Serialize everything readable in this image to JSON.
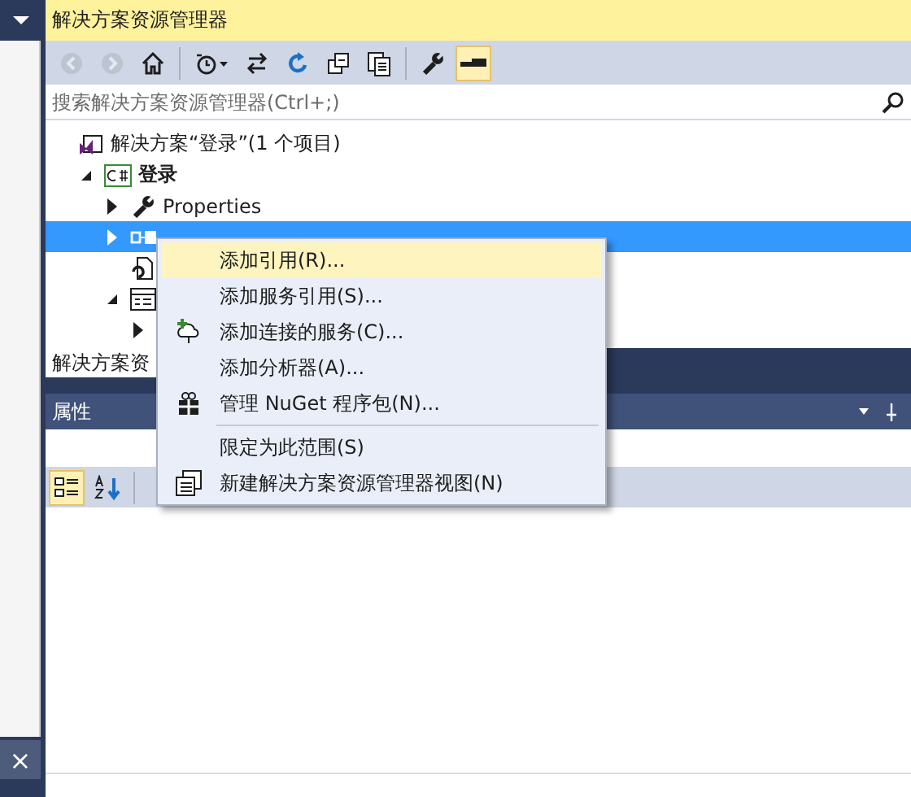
{
  "side_panel": {
    "close_label": "×"
  },
  "window": {
    "title": "解决方案资源管理器"
  },
  "toolbar": [
    {
      "kind": "back",
      "disabled": true
    },
    {
      "kind": "forward",
      "disabled": true
    },
    {
      "kind": "home",
      "disabled": false
    },
    {
      "kind": "separator"
    },
    {
      "kind": "history",
      "disabled": false
    },
    {
      "kind": "sync",
      "disabled": false
    },
    {
      "kind": "refresh",
      "disabled": false
    },
    {
      "kind": "collapse",
      "disabled": false
    },
    {
      "kind": "show_all",
      "disabled": false
    },
    {
      "kind": "separator"
    },
    {
      "kind": "properties",
      "disabled": false
    },
    {
      "kind": "preview",
      "disabled": false,
      "selected": true
    }
  ],
  "search": {
    "placeholder": "搜索解决方案资源管理器(Ctrl+;)"
  },
  "tree": [
    {
      "label": "解决方案“登录”(1 个项目)",
      "kind": "solution",
      "selected": false,
      "children": [
        {
          "label": "登录",
          "kind": "project",
          "expanded": true,
          "selected": false,
          "children": [
            {
              "label": "Properties",
              "kind": "properties",
              "expanded": false,
              "selected": false
            },
            {
              "kind": "references",
              "expanded": false,
              "selected": true
            },
            {
              "kind": "config",
              "selected": false
            },
            {
              "kind": "form",
              "expanded": true,
              "selected": false,
              "children": [
                {
                  "expanded": false,
                  "selected": false
                }
              ]
            }
          ]
        }
      ]
    }
  ],
  "tabs": [
    {
      "label": "解决方案资",
      "selected": true
    }
  ],
  "properties": {
    "title": "属性",
    "toolbar": [
      {
        "kind": "categorized",
        "selected": true
      },
      {
        "kind": "alphabetical",
        "selected": false
      }
    ]
  },
  "context_menu": [
    {
      "kind": "plain",
      "label": "添加引用(R)...",
      "selected": true
    },
    {
      "kind": "plain",
      "label": "添加服务引用(S)...",
      "selected": false
    },
    {
      "kind": "connected",
      "label": "添加连接的服务(C)...",
      "selected": false
    },
    {
      "kind": "plain",
      "label": "添加分析器(A)...",
      "selected": false
    },
    {
      "kind": "nuget",
      "label": "管理 NuGet 程序包(N)...",
      "selected": false
    },
    {
      "kind": "separator"
    },
    {
      "kind": "plain",
      "label": "限定为此范围(S)",
      "selected": false
    },
    {
      "kind": "new_view",
      "label": "新建解决方案资源管理器视图(N)",
      "selected": false
    }
  ]
}
